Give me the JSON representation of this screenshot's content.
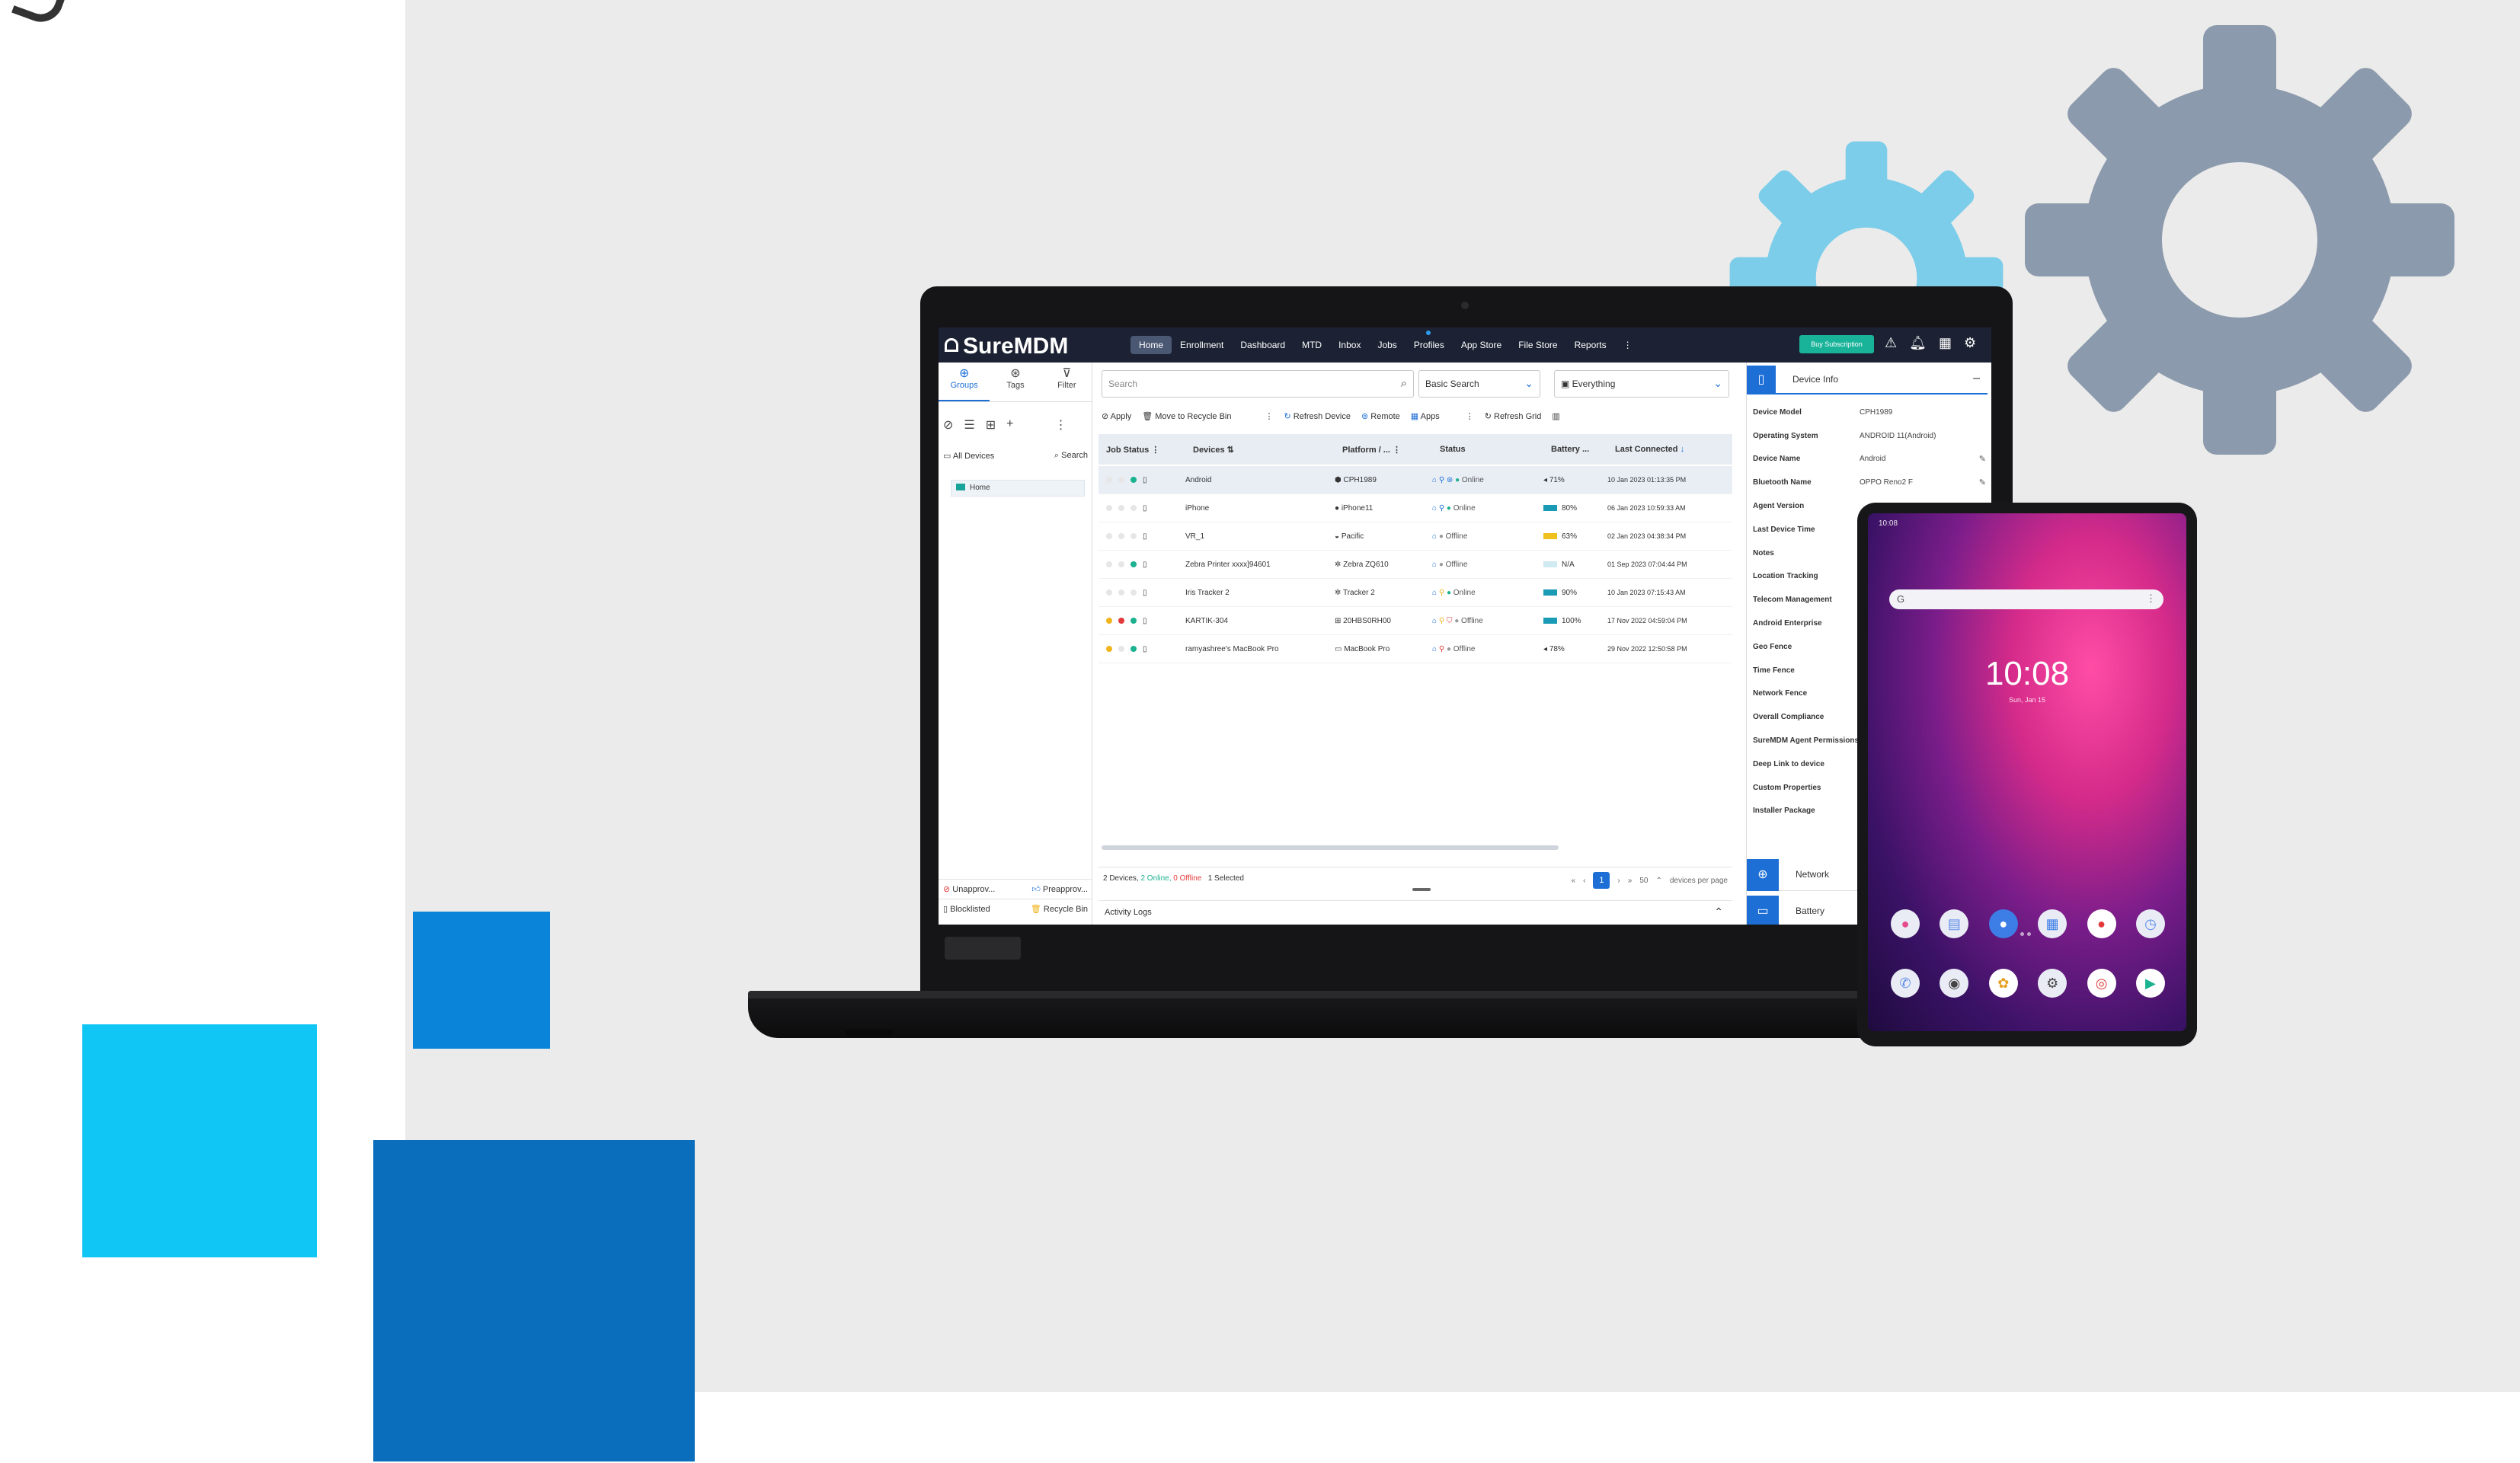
{
  "colors": {
    "background_panel": "#ebebeb",
    "square_blue": "#0a84d8",
    "square_cyan": "#10c6f4",
    "square_dark_blue": "#0a6ebd",
    "gear_gray": "#8b9aac",
    "gear_light_blue": "#7ccdea",
    "topbar": "#1c2233",
    "accent": "#1d6fd6",
    "subscribe_green": "#19b39a"
  },
  "app": {
    "brand": "SureMDM",
    "nav": [
      "Home",
      "Enrollment",
      "Dashboard",
      "MTD",
      "Inbox",
      "Jobs",
      "Profiles",
      "App Store",
      "File Store",
      "Reports"
    ],
    "subscribe_label": "Buy Subscription"
  },
  "sidebar": {
    "tabs": [
      {
        "label": "Groups",
        "icon": "groups-icon"
      },
      {
        "label": "Tags",
        "icon": "tag-icon"
      },
      {
        "label": "Filter",
        "icon": "filter-icon"
      }
    ],
    "all_devices": "All Devices",
    "search": "Search",
    "home_group": "Home",
    "bottom": {
      "unapproved": "Unapprov...",
      "preapproved": "Preapprov...",
      "blocklisted": "Blocklisted",
      "recycle_bin": "Recycle Bin"
    }
  },
  "center": {
    "search_placeholder": "Search",
    "basic_search": "Basic Search",
    "everything": "Everything",
    "actions": {
      "apply": "Apply",
      "move_to_recycle_bin": "Move to Recycle Bin",
      "refresh_device": "Refresh Device",
      "remote": "Remote",
      "apps": "Apps",
      "refresh_grid": "Refresh Grid"
    },
    "columns": [
      "Job Status",
      "Devices",
      "Platform / ...",
      "Status",
      "Battery ...",
      "Last Connected"
    ],
    "rows": [
      {
        "device": "Android",
        "platform": "CPH1989",
        "status": "Online",
        "battery": "71%",
        "last": "10 Jan 2023 01:13:35 PM"
      },
      {
        "device": "iPhone",
        "platform": "iPhone11",
        "status": "Online",
        "battery": "80%",
        "last": "06 Jan 2023 10:59:33 AM"
      },
      {
        "device": "VR_1",
        "platform": "Pacific",
        "status": "Offline",
        "battery": "63%",
        "last": "02 Jan 2023 04:38:34 PM"
      },
      {
        "device": "Zebra Printer xxxx]94601",
        "platform": "Zebra ZQ610",
        "status": "Offline",
        "battery": "N/A",
        "last": "01 Sep 2023 07:04:44 PM"
      },
      {
        "device": "Iris Tracker 2",
        "platform": "Tracker 2",
        "status": "Online",
        "battery": "90%",
        "last": "10 Jan 2023 07:15:43 AM"
      },
      {
        "device": "KARTIK-304",
        "platform": "20HBS0RH00",
        "status": "Offline",
        "battery": "100%",
        "last": "17 Nov 2022 04:59:04 PM"
      },
      {
        "device": "ramyashree's MacBook Pro",
        "platform": "MacBook Pro",
        "status": "Offline",
        "battery": "78%",
        "last": "29 Nov 2022 12:50:58 PM"
      }
    ],
    "footer": {
      "devices": "2 Devices,",
      "online": "2 Online,",
      "offline": "0 Offline",
      "selected": "1 Selected",
      "page": "1",
      "per_page_value": "50",
      "per_page_label": "devices per page"
    },
    "activity_logs": "Activity Logs"
  },
  "right_panel": {
    "title": "Device Info",
    "fields": [
      {
        "key": "Device Model",
        "value": "CPH1989"
      },
      {
        "key": "Operating System",
        "value": "ANDROID 11(Android)"
      },
      {
        "key": "Device Name",
        "value": "Android"
      },
      {
        "key": "Bluetooth Name",
        "value": "OPPO Reno2 F"
      },
      {
        "key": "Agent Version",
        "value": ""
      },
      {
        "key": "Last Device Time",
        "value": ""
      },
      {
        "key": "Notes",
        "value": ""
      },
      {
        "key": "Location Tracking",
        "value": ""
      },
      {
        "key": "Telecom Management",
        "value": ""
      },
      {
        "key": "Android Enterprise",
        "value": ""
      },
      {
        "key": "Geo Fence",
        "value": ""
      },
      {
        "key": "Time Fence",
        "value": ""
      },
      {
        "key": "Network Fence",
        "value": ""
      },
      {
        "key": "Overall Compliance",
        "value": ""
      },
      {
        "key": "SureMDM Agent Permissions",
        "value": ""
      },
      {
        "key": "Deep Link to device",
        "value": ""
      },
      {
        "key": "Custom Properties",
        "value": ""
      },
      {
        "key": "Installer Package",
        "value": ""
      }
    ],
    "network": "Network",
    "battery": "Battery"
  },
  "tablet": {
    "status_time": "10:08",
    "search_g": "G",
    "clock": "10:08",
    "date": "Sun, Jan 15"
  }
}
